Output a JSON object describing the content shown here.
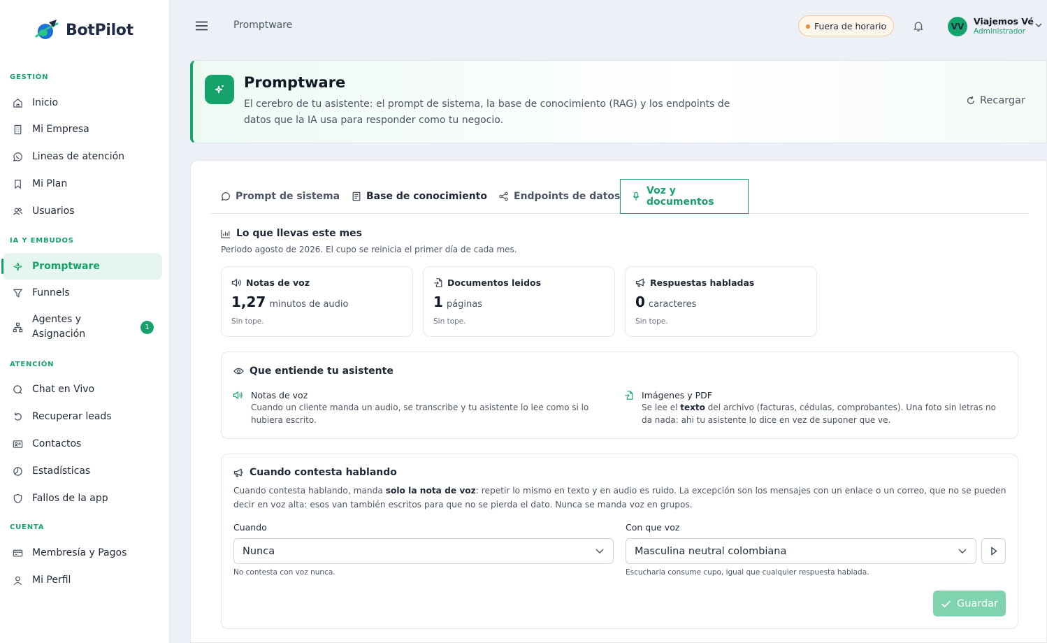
{
  "brand": {
    "name": "BotPilot"
  },
  "sidebar": {
    "sections": [
      {
        "label": "GESTIÓN"
      },
      {
        "label": "IA Y EMBUDOS"
      },
      {
        "label": "ATENCIÓN"
      },
      {
        "label": "CUENTA"
      }
    ],
    "items": [
      {
        "label": "Inicio",
        "icon": "home-icon"
      },
      {
        "label": "Mi Empresa",
        "icon": "building-icon"
      },
      {
        "label": "Lineas de atención",
        "icon": "whatsapp-icon"
      },
      {
        "label": "Mi Plan",
        "icon": "bookmark-icon"
      },
      {
        "label": "Usuarios",
        "icon": "users-icon"
      },
      {
        "label": "Promptware",
        "icon": "sparkle-icon",
        "active": true
      },
      {
        "label": "Funnels",
        "icon": "filter-icon"
      },
      {
        "label": "Agentes y\nAsignación",
        "icon": "hierarchy-icon",
        "badge": "1"
      },
      {
        "label": "Chat en Vivo",
        "icon": "chat-icon"
      },
      {
        "label": "Recuperar leads",
        "icon": "undo-icon"
      },
      {
        "label": "Contactos",
        "icon": "contact-card-icon"
      },
      {
        "label": "Estadísticas",
        "icon": "pie-chart-icon"
      },
      {
        "label": "Fallos de la app",
        "icon": "shield-icon"
      },
      {
        "label": "Membresía y Pagos",
        "icon": "credit-card-icon"
      },
      {
        "label": "Mi Perfil",
        "icon": "user-icon"
      }
    ]
  },
  "topbar": {
    "title": "Promptware",
    "status": "Fuera de horario",
    "user": {
      "initials": "VV",
      "name": "Viajemos Vé",
      "role": "Administrador"
    }
  },
  "header": {
    "title": "Promptware",
    "description": "El cerebro de tu asistente: el prompt de sistema, la base de conocimiento (RAG) y los endpoints de datos que la IA usa para responder como tu negocio.",
    "reload_label": "Recargar"
  },
  "tabs": [
    {
      "label": "Prompt de sistema"
    },
    {
      "label": "Base de conocimiento"
    },
    {
      "label": "Endpoints de datos"
    },
    {
      "label": "Voz y documentos",
      "active": true
    }
  ],
  "usage": {
    "title": "Lo que llevas este mes",
    "subtitle": "Periodo agosto de 2026. El cupo se reinicia el primer día de cada mes.",
    "cards": [
      {
        "label": "Notas de voz",
        "value": "1,27",
        "unit": "minutos de audio",
        "cap": "Sin tope."
      },
      {
        "label": "Documentos leidos",
        "value": "1",
        "unit": "páginas",
        "cap": "Sin tope."
      },
      {
        "label": "Respuestas habladas",
        "value": "0",
        "unit": "caracteres",
        "cap": "Sin tope."
      }
    ]
  },
  "understands": {
    "title": "Que entiende tu asistente",
    "features": [
      {
        "title": "Notas de voz",
        "desc": "Cuando un cliente manda un audio, se transcribe y tu asistente lo lee como si lo hubiera escrito."
      },
      {
        "title": "Imágenes y PDF",
        "desc_pre": "Se lee el ",
        "desc_bold": "texto",
        "desc_post": " del archivo (facturas, cédulas, comprobantes). Una foto sin letras no da nada: ahi tu asistente lo dice en vez de suponer que ve."
      }
    ]
  },
  "speaking": {
    "title": "Cuando contesta hablando",
    "desc_pre": "Cuando contesta hablando, manda ",
    "desc_bold": "solo la nota de voz",
    "desc_post": ": repetir lo mismo en texto y en audio es ruido. La excepción son los mensajes con un enlace o un correo, que no se pueden decir en voz alta: esos van también escritos para que no se pierda el dato. Nunca se manda voz en grupos.",
    "when": {
      "label": "Cuando",
      "value": "Nunca",
      "help": "No contesta con voz nunca."
    },
    "voice": {
      "label": "Con que voz",
      "value": "Masculina neutral colombiana",
      "help": "Escucharla consume cupo, igual que cualquier respuesta hablada."
    },
    "save_label": "Guardar"
  },
  "colors": {
    "accent": "#15a36b",
    "accent_light": "#e4f6ee",
    "save_disabled": "#7fd3ae",
    "status_dot": "#f08a24"
  }
}
